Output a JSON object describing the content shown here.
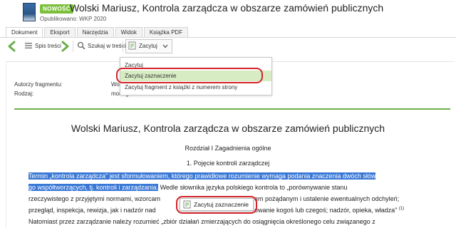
{
  "header": {
    "badge": "NOWOŚĆ",
    "title": "Wolski Mariusz, Kontrola zarządcza w obszarze zamówień publicznych",
    "published": "Opublikowano: WKP 2020"
  },
  "tabs": [
    {
      "label": "Dokument",
      "active": true
    },
    {
      "label": "Eksport",
      "active": false
    },
    {
      "label": "Narzędzia",
      "active": false
    },
    {
      "label": "Widok",
      "active": false
    },
    {
      "label": "Książka PDF",
      "active": false
    }
  ],
  "toolbar": {
    "toc_label": "Spis treści",
    "search_label": "Szukaj w treści",
    "cite_label": "Zacytuj"
  },
  "dropdown": {
    "items": [
      "Zacytuj",
      "Zacytuj zaznaczenie",
      "Zacytuj fragment z książki z numerem strony"
    ]
  },
  "meta": {
    "authors_label": "Autorzy fragmentu:",
    "authors_value": "Wols",
    "type_label": "Rodzaj:",
    "type_value": "monog"
  },
  "document": {
    "title": "Wolski Mariusz, Kontrola zarządcza w obszarze zamówień publicznych",
    "chapter": "Rozdział I Zagadnienia ogólne",
    "section": "1. Pojęcie kontroli zarządczej",
    "line1_sel": "Termin „kontrola zarządcza\" jest sformułowaniem, którego prawidłowe rozumienie wymaga podania znaczenia dwóch słów",
    "line2_sel": "go współtworzących, tj. kontroli i zarządzania.",
    "line2_rest": " Wedle słownika języka polskiego kontrola to „porównywanie stanu",
    "line3_a": "rzeczywistego z przyjętymi normami, wzorcam",
    "line3_b": "em pożądanym i ustalenie ewentualnych odchyleń;",
    "line4_a": "przegląd, inspekcja, rewizja, jak i nadzór nad",
    "line4_b": "owanie kogoś lub czegoś; nadzór, opieka, władza\"",
    "line4_fn": "(1)",
    "line5": "Natomiast przez zarządzanie należy rozumieć „zbiór działań zmierzających do osiągnięcia określonego celu związanego z"
  },
  "popup": {
    "label": "Zacytuj zaznaczenie"
  },
  "colors": {
    "badge": "#7bbf3a",
    "selection": "#3a78d6",
    "highlight": "#d7ecc3",
    "annotation": "#d4232a",
    "accent_rule": "#6ab04c"
  }
}
